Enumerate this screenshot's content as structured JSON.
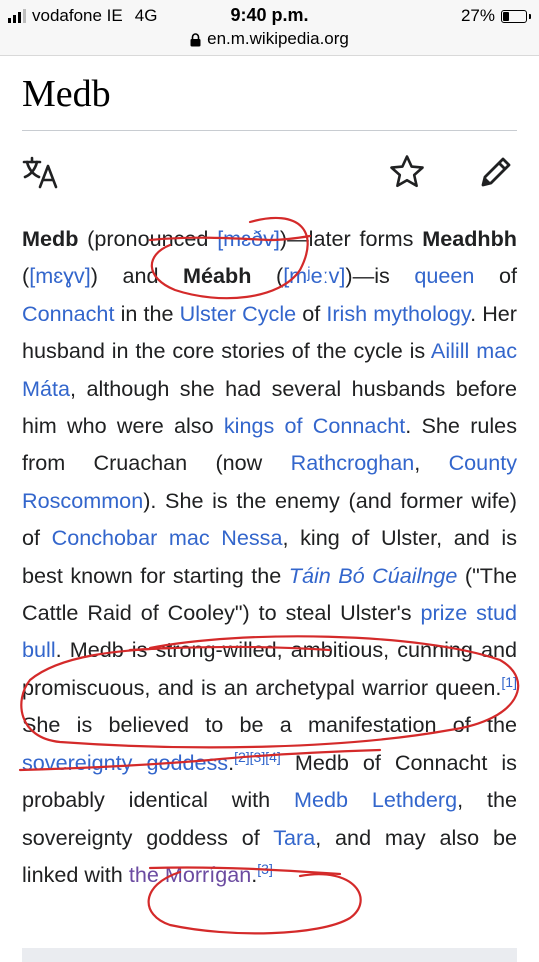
{
  "status": {
    "carrier": "vodafone IE",
    "network": "4G",
    "time": "9:40 p.m.",
    "battery": "27%",
    "battery_level": 0.27,
    "url": "en.m.wikipedia.org"
  },
  "page": {
    "title": "Medb"
  },
  "toolbar": {
    "icons": [
      "language-icon",
      "star-icon",
      "edit-pencil-icon"
    ]
  },
  "article": {
    "s1_name": "Medb",
    "s1_pron": " (pronounced ",
    "s1_ipa1": "[mɛðv]",
    "s1_t1": ")—later forms ",
    "s1_name2": "Meadhbh",
    "s1_t2": " (",
    "s1_ipa2": "[mɛɣv]",
    "s1_t3": ") and ",
    "s1_name3": "Méabh",
    "s1_t4": " (",
    "s1_ipa3": "[mʲeːv]",
    "s1_t5": ")—is ",
    "link_queen": "queen",
    "s1_t6": " of ",
    "link_connacht": "Connacht",
    "s1_t7": " in the ",
    "link_ulster_cycle": "Ulster Cycle",
    "s1_t8": " of ",
    "link_irish_myth": "Irish mythology",
    "s1_t9": ". Her husband in the core stories of the cycle is ",
    "link_ailill": "Ailill mac Máta",
    "s1_t10": ", although she had several hus­bands before him who were also ",
    "link_kings": "kings of Con­nacht",
    "s1_t11": ". She rules from Cruachan (now ",
    "link_rathcroghan": "Rathcroghan",
    "s1_t12": ", ",
    "link_roscommon": "County Roscommon",
    "s1_t13": "). She is the enemy (and former wife) of ",
    "link_conchobar": "Conchobar mac Nessa",
    "s1_t14": ", king of Ulster, and is best known for starting the ",
    "link_tain": "Táin Bó Cúailnge",
    "s1_t15": " (\"The Cattle Raid of Cooley\") to steal Ulster's ",
    "link_bull": "prize stud bull",
    "s1_t16": ". Medb is strong-willed, ambitious, cunning and promiscuous, and is an archetypal warrior queen.",
    "ref1": "[1]",
    "s1_t17": " She is believed to be a manifestation of the ",
    "link_sovereignty": "sovereignty goddess",
    "s1_t18": ".",
    "ref2": "[2]",
    "ref3": "[3]",
    "ref4": "[4]",
    "s1_t19": " Medb of Con­nacht is probably identical with ",
    "link_lethderg": "Medb Lethderg",
    "s1_t20": ", the sovereignty goddess of ",
    "link_tara": "Tara",
    "s1_t21": ", and may also be linked with ",
    "link_morrigan": "the Morrígan",
    "s1_t22": ".",
    "ref5": "[3]"
  },
  "colors": {
    "link": "#3366cc",
    "visited_link": "#6b4ba1",
    "annotation_ink": "#d42a2a",
    "status_bg": "#f7f7f7"
  }
}
